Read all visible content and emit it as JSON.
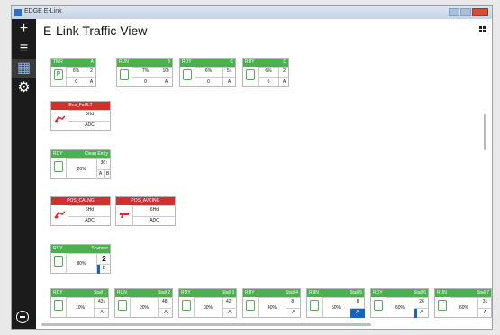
{
  "window": {
    "title": "EDGE E-Link",
    "title_short": "EDGE E-Link"
  },
  "header": {
    "title": "E-Link Traffic View"
  },
  "sidebar": {
    "items": [
      {
        "icon": "plus-icon",
        "glyph": "+"
      },
      {
        "icon": "menu-icon",
        "glyph": "≡"
      },
      {
        "icon": "grid-icon",
        "glyph": "▦"
      },
      {
        "icon": "gear-icon",
        "glyph": "⚙"
      },
      {
        "icon": "minus-circle-icon",
        "glyph": ""
      }
    ]
  },
  "tiles_row1": [
    {
      "status": "TMR",
      "name": "A",
      "icon_letter": "P",
      "pct": "6%",
      "count": "2",
      "v1": "0",
      "v2": "A"
    },
    {
      "status": "RUN",
      "name": "B",
      "icon_letter": "",
      "pct": "7%",
      "count": "10↑",
      "v1": "0",
      "v2": "A"
    },
    {
      "status": "RDY",
      "name": "C",
      "icon_letter": "",
      "pct": "6%",
      "count": "5↓",
      "v1": "0",
      "v2": "A"
    },
    {
      "status": "RDY",
      "name": "D",
      "icon_letter": "",
      "pct": "6%",
      "count": "2",
      "v1": "0",
      "v2": "A"
    }
  ],
  "tile_fault": {
    "name": "Ens_FaULT",
    "line1": "6Hd",
    "line2": "ADC"
  },
  "tile_clean": {
    "status": "RDY",
    "name": "Clean Entry",
    "pct": "26%",
    "count": "36↑",
    "v1": "A",
    "v2": "B"
  },
  "tile_pos1": {
    "name": "POS_CALNG",
    "line1": "6Hd",
    "line2": "ADC"
  },
  "tile_pos2": {
    "name": "POS_AVCING",
    "line1": "6Hd",
    "line2": "ADC"
  },
  "tile_scanner": {
    "status": "RDY",
    "name": "Scanner",
    "pct": "80%",
    "count": "2",
    "v1": "B"
  },
  "bottom_tiles": [
    {
      "status": "RDY",
      "name": "Stall 1",
      "pct": "10%",
      "count": "43↓",
      "v": "A"
    },
    {
      "status": "RUN",
      "name": "Stall 2",
      "pct": "20%",
      "count": "48↓",
      "v": "A"
    },
    {
      "status": "RDY",
      "name": "Stall 3",
      "pct": "30%",
      "count": "42↑",
      "v": "A"
    },
    {
      "status": "RDY",
      "name": "Stall 4",
      "pct": "40%",
      "count": "8↑",
      "v": "A"
    },
    {
      "status": "RUN",
      "name": "Stall 5",
      "pct": "50%",
      "count": "8",
      "v": "A"
    },
    {
      "status": "RDY",
      "name": "Stall 6",
      "pct": "60%",
      "count": "26",
      "v": "A"
    },
    {
      "status": "RUN",
      "name": "Stall 7",
      "pct": "60%",
      "count": "31",
      "v": "A"
    }
  ]
}
